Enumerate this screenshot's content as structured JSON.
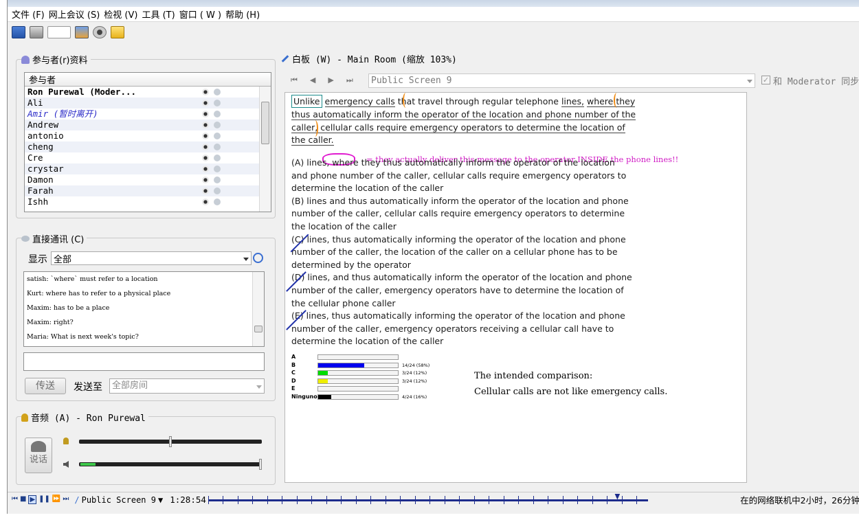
{
  "menu": {
    "items": [
      "文件 (F)",
      "网上会议 (S)",
      "检视 (V)",
      "工具 (T)",
      "窗口 ( W )",
      "帮助 (H)"
    ]
  },
  "participants": {
    "title": "参与者(r)资料",
    "column": "参与者",
    "rows": [
      {
        "name": "Ron Purewal (Moder...",
        "style": "bold"
      },
      {
        "name": "Ali",
        "style": "normal"
      },
      {
        "name": "Amir (暂时离开)",
        "style": "away"
      },
      {
        "name": "Andrew",
        "style": "normal"
      },
      {
        "name": "antonio",
        "style": "normal"
      },
      {
        "name": "cheng",
        "style": "normal"
      },
      {
        "name": "Cre",
        "style": "normal"
      },
      {
        "name": "crystar",
        "style": "normal"
      },
      {
        "name": "Damon",
        "style": "normal"
      },
      {
        "name": "Farah",
        "style": "normal"
      },
      {
        "name": "Ishh",
        "style": "normal"
      }
    ]
  },
  "chat": {
    "title": "直接通讯 (C)",
    "show_label": "显示",
    "filter_value": "全部",
    "messages": [
      "satish: `where` must refer to a location",
      "Kurt: where has to refer to a physical place",
      "Maxim: has to be a place",
      "Maxim: right?",
      "Maria: What is next week's topic?"
    ],
    "input_value": "",
    "send_label": "传送",
    "send_to_label": "发送至",
    "send_to_value": "全部房间"
  },
  "audio": {
    "title": "音频 (A) - Ron Purewal",
    "talk_label": "说话",
    "mic_level": 0.5,
    "speaker_level": 1.0
  },
  "whiteboard": {
    "title": "白板 (W) - Main Room (缩放 103%)",
    "screen_select": "Public Screen 9",
    "moderator_sync": "和 Moderator 同步",
    "paragraph": [
      "Unlike emergency calls that travel through regular telephone lines, where they",
      "thus automatically inform the operator of the location and phone number of the",
      "caller, cellular calls require emergency operators to determine the location of",
      "the caller."
    ],
    "annotation": "= they actually deliver this message to the operator INSIDE the phone lines!!",
    "choices": [
      "(A) lines, where they thus automatically inform the operator of the location",
      "and phone number of the caller, cellular calls require emergency operators to",
      "determine the location of the caller",
      "(B) lines and thus automatically inform the operator of the location and phone",
      "number of the caller, cellular calls require emergency operators to determine",
      "the location of the caller",
      "(C) lines, thus automatically informing the operator of the location and phone",
      "number of the caller, the location of the caller on a cellular phone has to be",
      "determined by the operator",
      "(D) lines, and thus automatically inform the operator of the location and phone",
      "number of the caller, emergency operators have to determine the location of",
      "the cellular phone caller",
      "(E) lines, thus automatically informing the operator of the location and phone",
      "number of the caller, emergency operators receiving a cellular call have to",
      "determine the location of the caller"
    ],
    "poll": [
      {
        "label": "A",
        "text": "",
        "fraction": 0,
        "color": "#0000ee"
      },
      {
        "label": "B",
        "text": "14/24 (58%)",
        "fraction": 0.58,
        "color": "#0000ee"
      },
      {
        "label": "C",
        "text": "3/24 (12%)",
        "fraction": 0.12,
        "color": "#00dd00"
      },
      {
        "label": "D",
        "text": "3/24 (12%)",
        "fraction": 0.12,
        "color": "#eeee00"
      },
      {
        "label": "E",
        "text": "",
        "fraction": 0,
        "color": "#0000ee"
      },
      {
        "label": "Ninguno",
        "text": "4/24 (16%)",
        "fraction": 0.16,
        "color": "#000000"
      }
    ],
    "note_line1": "The intended comparison:",
    "note_line2": "Cellular calls are not like emergency calls."
  },
  "status": {
    "screen": "Public Screen 9",
    "time": "1:28:54",
    "progress": 0.93,
    "online_text": "在的网络联机中2小时，26分钟"
  }
}
